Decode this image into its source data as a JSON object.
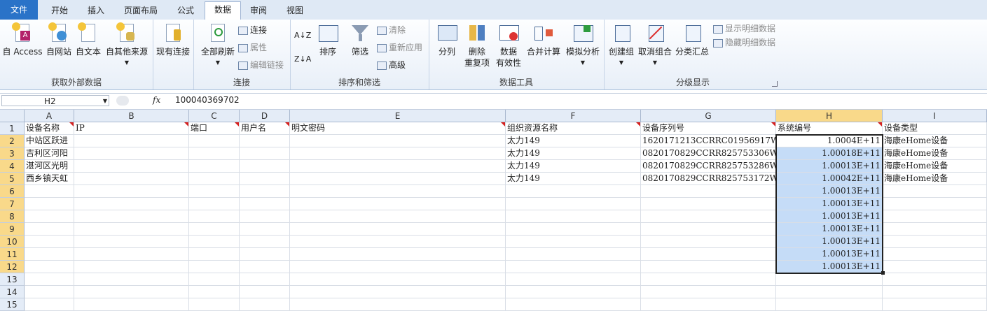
{
  "tabs": [
    {
      "id": "file",
      "label": "文件"
    },
    {
      "id": "start",
      "label": "开始"
    },
    {
      "id": "insert",
      "label": "插入"
    },
    {
      "id": "layout",
      "label": "页面布局"
    },
    {
      "id": "formula",
      "label": "公式"
    },
    {
      "id": "data",
      "label": "数据"
    },
    {
      "id": "review",
      "label": "审阅"
    },
    {
      "id": "view",
      "label": "视图"
    }
  ],
  "ribbon": {
    "external": {
      "label": "获取外部数据",
      "from_access": "自 Access",
      "from_web": "自网站",
      "from_text": "自文本",
      "from_other": "自其他来源",
      "existing": "现有连接"
    },
    "connections": {
      "label": "连接",
      "refresh_all": "全部刷新",
      "connect": "连接",
      "properties": "属性",
      "edit_links": "编辑链接"
    },
    "sort_filter": {
      "label": "排序和筛选",
      "sort": "排序",
      "filter": "筛选",
      "clear": "清除",
      "reapply": "重新应用",
      "advanced": "高级",
      "az": "A↓Z",
      "za": "Z↓A"
    },
    "data_tools": {
      "label": "数据工具",
      "split": "分列",
      "remove_dup_1": "删除",
      "remove_dup_2": "重复项",
      "validation_1": "数据",
      "validation_2": "有效性",
      "consolidate": "合并计算",
      "whatif": "模拟分析"
    },
    "outline": {
      "label": "分级显示",
      "group": "创建组",
      "ungroup": "取消组合",
      "subtotal": "分类汇总",
      "show_detail": "显示明细数据",
      "hide_detail": "隐藏明细数据"
    }
  },
  "formula_bar": {
    "name_box": "H2",
    "fx": "fx",
    "value": "100040369702"
  },
  "columns": [
    "A",
    "B",
    "C",
    "D",
    "E",
    "F",
    "G",
    "H",
    "I"
  ],
  "rows": [
    "1",
    "2",
    "3",
    "4",
    "5",
    "6",
    "7",
    "8",
    "9",
    "10",
    "11",
    "12",
    "13",
    "14",
    "15"
  ],
  "sheet": {
    "header": [
      "设备名称",
      "IP",
      "端口",
      "用户名",
      "明文密码",
      "组织资源名称",
      "设备序列号",
      "系统编号",
      "设备类型"
    ],
    "data": [
      [
        "中站区跃进",
        "",
        "",
        "",
        "",
        "太力149",
        "1620171213CCRRC01956917W",
        "1.0004E+11",
        "海康eHome设备"
      ],
      [
        "吉利区河阳",
        "",
        "",
        "",
        "",
        "太力149",
        "0820170829CCRR825753306W",
        "1.00018E+11",
        "海康eHome设备"
      ],
      [
        "湛河区光明",
        "",
        "",
        "",
        "",
        "太力149",
        "0820170829CCRR825753286W",
        "1.00013E+11",
        "海康eHome设备"
      ],
      [
        "西乡镇天虹",
        "",
        "",
        "",
        "",
        "太力149",
        "0820170829CCRR825753172W",
        "1.00042E+11",
        "海康eHome设备"
      ]
    ],
    "h_extra": [
      "1.00013E+11",
      "1.00013E+11",
      "1.00013E+11",
      "1.00013E+11",
      "1.00013E+11",
      "1.00013E+11",
      "1.00013E+11"
    ]
  }
}
